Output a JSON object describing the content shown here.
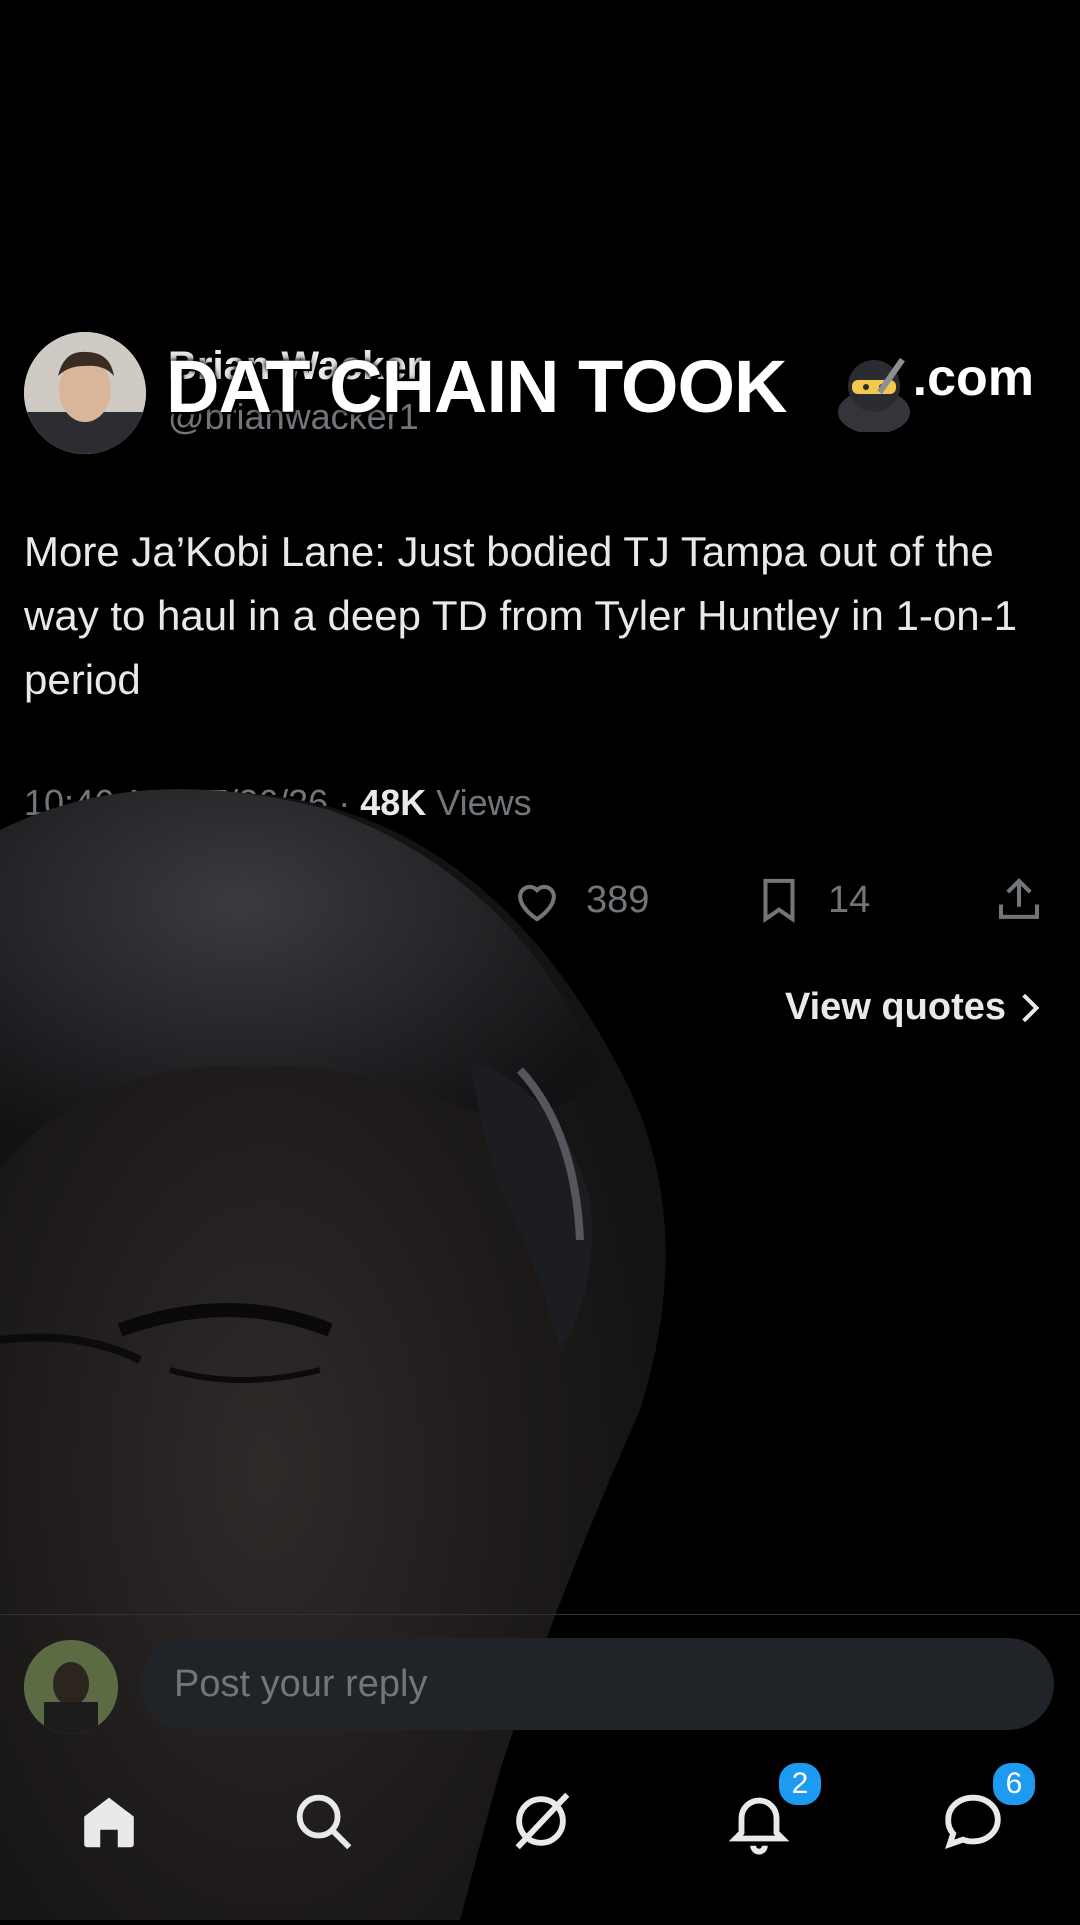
{
  "post": {
    "author_name": "Brian Wacker",
    "author_handle": "@brianwacker1",
    "domain_suffix": ".com",
    "text": "More Ja’Kobi Lane: Just bodied TJ Tampa out of the way to haul in a deep TD from Tyler Huntley in 1-on-1 period",
    "timestamp": "10:46 AM · 7/26/26 ·",
    "views_count": "48K",
    "views_label": "Views",
    "likes": "389",
    "bookmarks": "14",
    "view_quotes": "View quotes"
  },
  "overlay": {
    "caption": "DAT CHAIN TOOK",
    "emoji": "ninja-emoji"
  },
  "reply": {
    "placeholder": "Post your reply"
  },
  "tabbar": {
    "notifications_badge": "2",
    "messages_badge": "6"
  },
  "colors": {
    "background": "#000000",
    "text": "#e7e9ea",
    "muted": "#71767b",
    "accent": "#1d9bf0"
  }
}
